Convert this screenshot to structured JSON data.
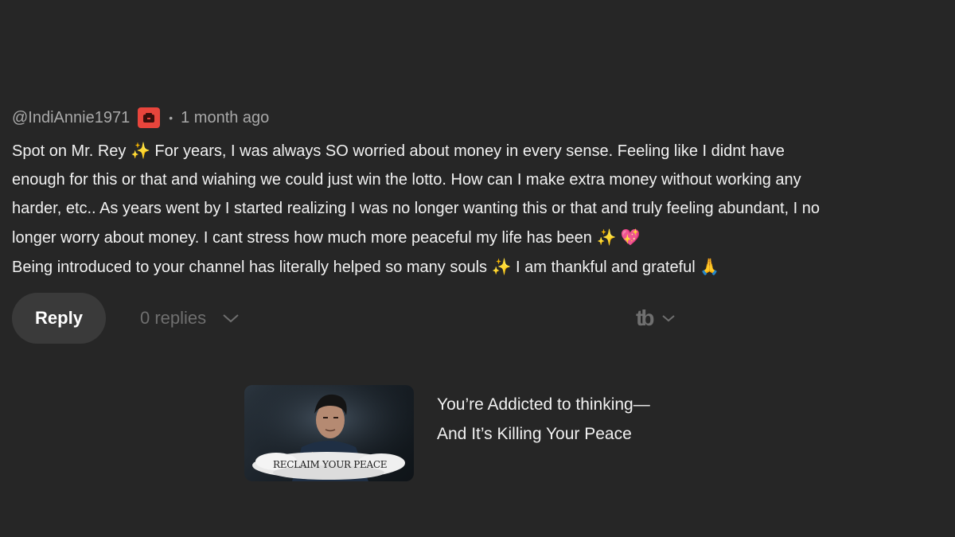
{
  "comment": {
    "author": "@IndiAnnie1971",
    "badge_icon": "membership-badge-icon",
    "badge_color": "#e8453c",
    "separator": "•",
    "timestamp": "1 month ago",
    "lines": [
      {
        "text": "Spot on Mr. Rey ",
        "emoji": "✨",
        "after": " For years, I was always SO worried about money in every sense. Feeling like I didnt have"
      },
      {
        "text": "enough for this or that and wiahing we could just win the lotto. How can I make extra money without working any"
      },
      {
        "text": "harder, etc.. As years went by I started realizing I was no longer wanting this or that and truly feeling abundant, I no"
      },
      {
        "text": "longer worry about money. I cant stress how much more peaceful my life has been ",
        "emoji": "✨",
        "emoji2": "💖"
      },
      {
        "text": "Being introduced to your channel has literally helped so many souls ",
        "emoji": "✨",
        "after": " I am thankful and grateful ",
        "emoji2": "🙏"
      }
    ]
  },
  "actions": {
    "reply_label": "Reply",
    "replies_label": "0 replies",
    "replies_icon": "chevron-down-icon",
    "extension_logo": "tb",
    "extension_icon": "chevron-down-icon"
  },
  "video": {
    "thumbnail_caption": "RECLAIM YOUR PEACE",
    "title_line1": "You’re Addicted to thinking—",
    "title_line2": "And It’s Killing Your Peace"
  }
}
